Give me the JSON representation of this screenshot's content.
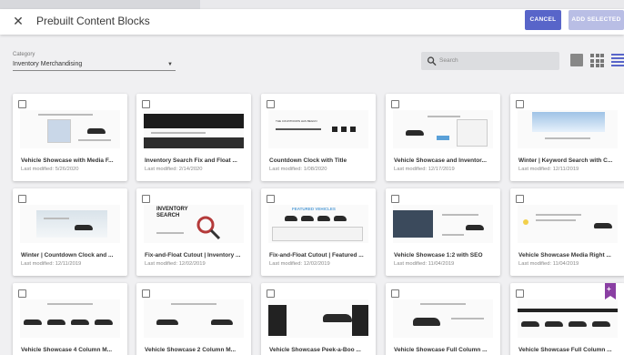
{
  "header": {
    "title": "Prebuilt Content Blocks",
    "cancel_label": "CANCEL",
    "add_label": "ADD SELECTED"
  },
  "filters": {
    "category_label": "Category",
    "category_value": "Inventory Merchandising",
    "search_placeholder": "Search"
  },
  "colors": {
    "accent": "#5865c9",
    "accent_disabled": "#b9bee5",
    "bookmark": "#8a3fa3"
  },
  "icons": [
    "close-icon",
    "search-icon",
    "tile-view-icon",
    "grid-view-icon",
    "list-view-icon",
    "caret-down-icon",
    "bookmark-icon"
  ],
  "blocks": [
    {
      "name": "Vehicle Showcase with Media F...",
      "modified": "Last modified: 5/26/2020"
    },
    {
      "name": "Inventory Search Fix and Float ...",
      "modified": "Last modified: 2/14/2020"
    },
    {
      "name": "Countdown Clock with Title",
      "modified": "Last modified: 1/08/2020"
    },
    {
      "name": "Vehicle Showcase and Inventor...",
      "modified": "Last modified: 12/17/2019"
    },
    {
      "name": "Winter | Keyword Search with C...",
      "modified": "Last modified: 12/11/2019"
    },
    {
      "name": "Winter | Countdown Clock and ...",
      "modified": "Last modified: 12/11/2019"
    },
    {
      "name": "Fix-and-Float Cutout | Inventory ...",
      "modified": "Last modified: 12/02/2019"
    },
    {
      "name": "Fix-and-Float Cutout | Featured ...",
      "modified": "Last modified: 12/02/2019"
    },
    {
      "name": "Vehicle Showcase 1:2 with SEO",
      "modified": "Last modified: 11/04/2019"
    },
    {
      "name": "Vehicle Showcase Media Right ...",
      "modified": "Last modified: 11/04/2019"
    },
    {
      "name": "Vehicle Showcase 4 Column M...",
      "modified": ""
    },
    {
      "name": "Vehicle Showcase 2 Column M...",
      "modified": ""
    },
    {
      "name": "Vehicle Showcase Peek-a-Boo ...",
      "modified": ""
    },
    {
      "name": "Vehicle Showcase Full Column ...",
      "modified": ""
    },
    {
      "name": "Vehicle Showcase Full Column ...",
      "modified": ""
    }
  ],
  "thumb_text": {
    "countdown": "THE COUNTDOWN HAS BEGUN",
    "inventory_search": "INVENTORY SEARCH",
    "featured_vehicles": "FEATURED VEHICLES"
  }
}
